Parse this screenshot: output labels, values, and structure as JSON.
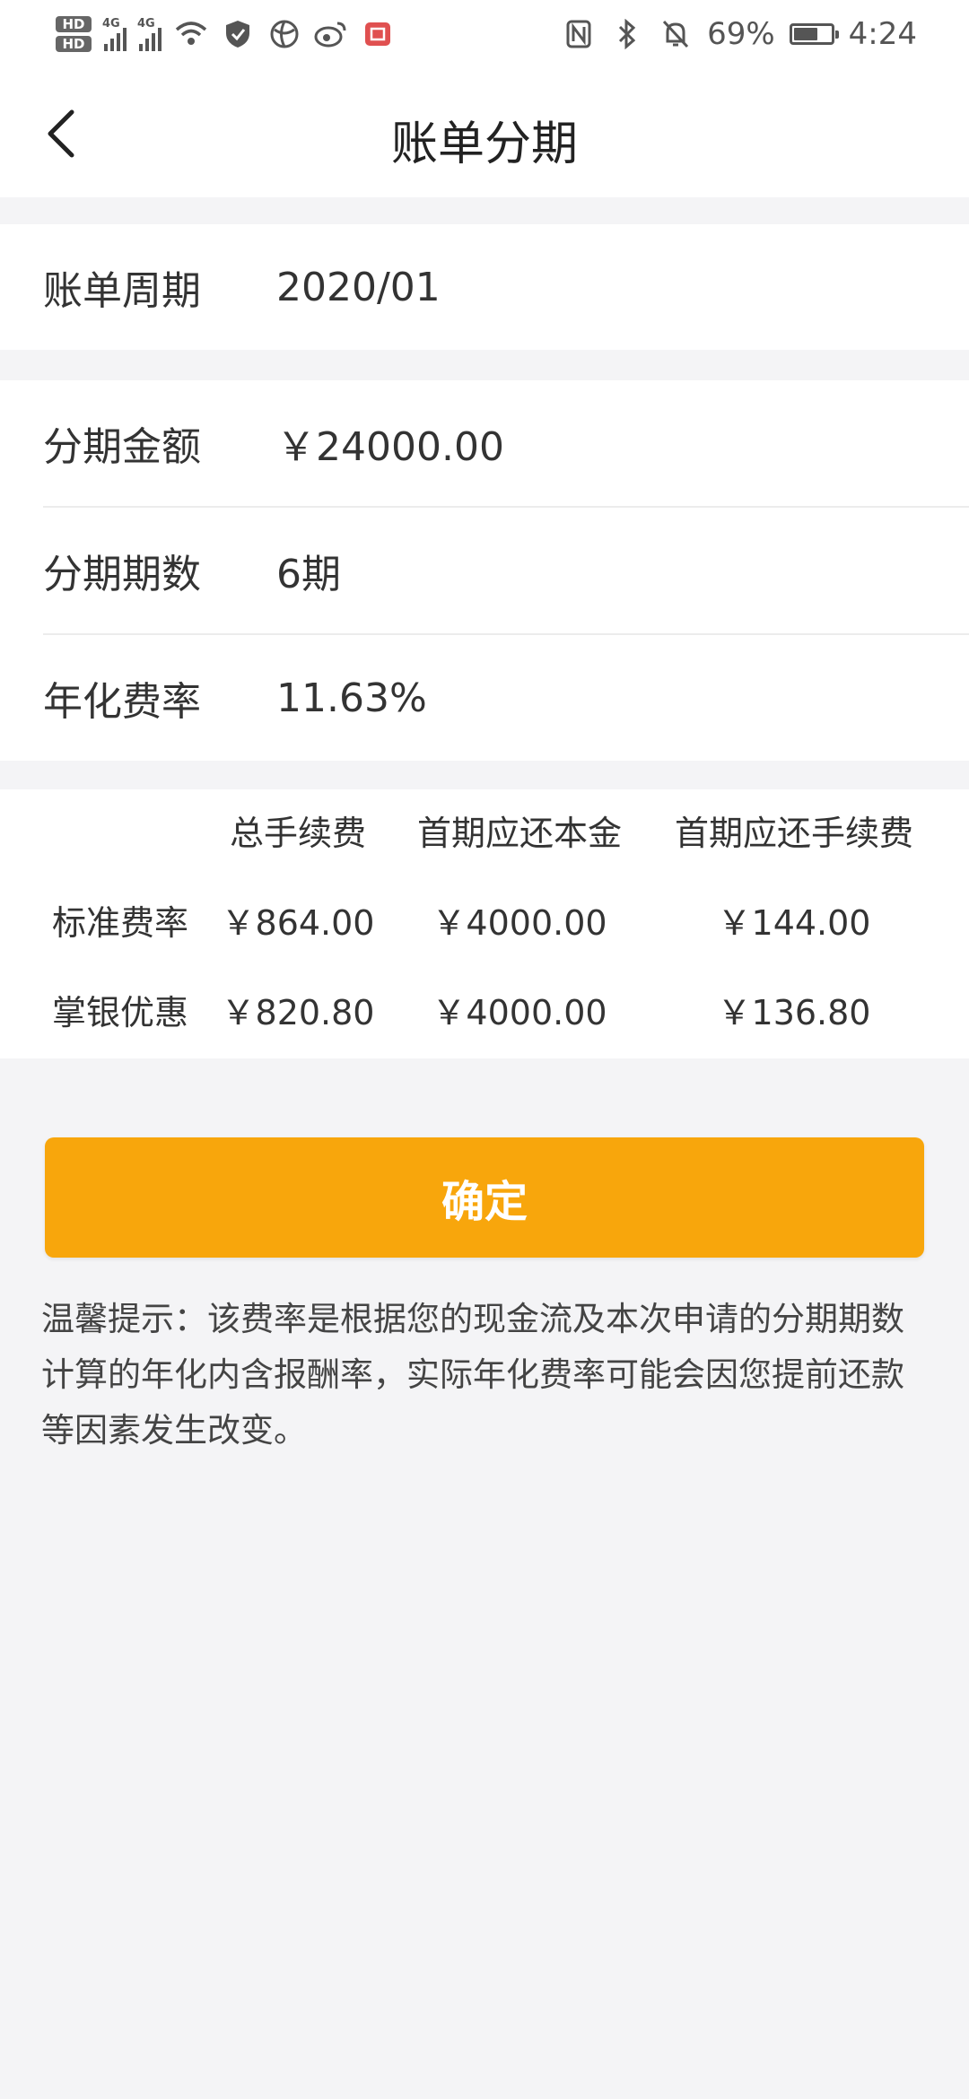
{
  "status_bar": {
    "signal_1": "4G",
    "signal_2": "4G",
    "battery_percent": "69%",
    "battery_level": 0.69,
    "time": "4:24",
    "hd1": "HD",
    "hd2": "HD"
  },
  "header": {
    "title": "账单分期"
  },
  "bill_period": {
    "label": "账单周期",
    "value": "2020/01"
  },
  "installment": {
    "amount_label": "分期金额",
    "amount_value": "￥24000.00",
    "periods_label": "分期期数",
    "periods_value": "6期",
    "rate_label": "年化费率",
    "rate_value": "11.63%"
  },
  "fees": {
    "headers": [
      "总手续费",
      "首期应还本金",
      "首期应还手续费"
    ],
    "rows": [
      {
        "label": "标准费率",
        "values": [
          "￥864.00",
          "￥4000.00",
          "￥144.00"
        ]
      },
      {
        "label": "掌银优惠",
        "values": [
          "￥820.80",
          "￥4000.00",
          "￥136.80"
        ]
      }
    ]
  },
  "confirm_button": "确定",
  "tip": "温馨提示：该费率是根据您的现金流及本次申请的分期期数计算的年化内含报酬率，实际年化费率可能会因您提前还款等因素发生改变。",
  "colors": {
    "accent": "#f8a60c",
    "background": "#f4f4f6"
  }
}
